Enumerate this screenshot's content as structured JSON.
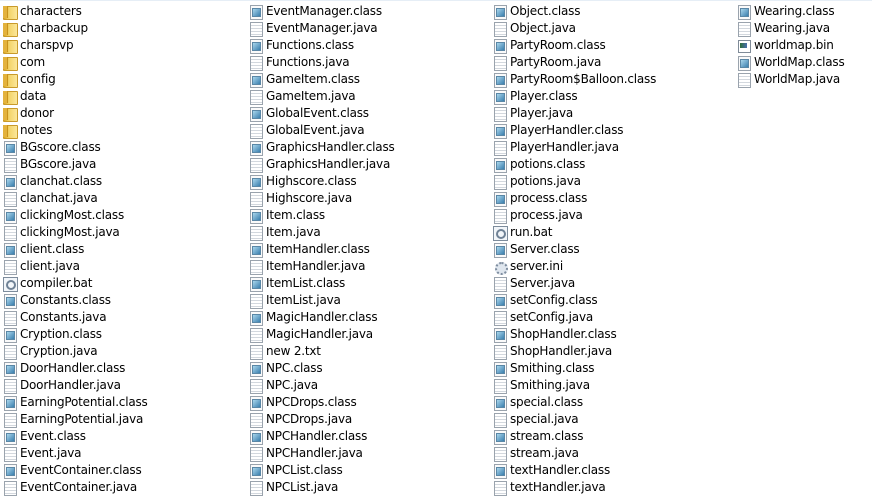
{
  "columns": [
    {
      "items": [
        {
          "name": "characters",
          "icon": "folder-icon",
          "type": "folder"
        },
        {
          "name": "charbackup",
          "icon": "folder-icon",
          "type": "folder"
        },
        {
          "name": "charspvp",
          "icon": "folder-icon",
          "type": "folder"
        },
        {
          "name": "com",
          "icon": "folder-icon",
          "type": "folder"
        },
        {
          "name": "config",
          "icon": "folder-icon",
          "type": "folder"
        },
        {
          "name": "data",
          "icon": "folder-icon",
          "type": "folder"
        },
        {
          "name": "donor",
          "icon": "folder-icon",
          "type": "folder"
        },
        {
          "name": "notes",
          "icon": "folder-icon",
          "type": "folder"
        },
        {
          "name": "BGscore.class",
          "icon": "class-file-icon",
          "type": "cls"
        },
        {
          "name": "BGscore.java",
          "icon": "text-file-icon",
          "type": "doc"
        },
        {
          "name": "clanchat.class",
          "icon": "class-file-icon",
          "type": "cls"
        },
        {
          "name": "clanchat.java",
          "icon": "text-file-icon",
          "type": "doc"
        },
        {
          "name": "clickingMost.class",
          "icon": "class-file-icon",
          "type": "cls"
        },
        {
          "name": "clickingMost.java",
          "icon": "text-file-icon",
          "type": "doc"
        },
        {
          "name": "client.class",
          "icon": "class-file-icon",
          "type": "cls"
        },
        {
          "name": "client.java",
          "icon": "text-file-icon",
          "type": "doc"
        },
        {
          "name": "compiler.bat",
          "icon": "batch-file-icon",
          "type": "bat"
        },
        {
          "name": "Constants.class",
          "icon": "class-file-icon",
          "type": "cls"
        },
        {
          "name": "Constants.java",
          "icon": "text-file-icon",
          "type": "doc"
        },
        {
          "name": "Cryption.class",
          "icon": "class-file-icon",
          "type": "cls"
        },
        {
          "name": "Cryption.java",
          "icon": "text-file-icon",
          "type": "doc"
        },
        {
          "name": "DoorHandler.class",
          "icon": "class-file-icon",
          "type": "cls"
        },
        {
          "name": "DoorHandler.java",
          "icon": "text-file-icon",
          "type": "doc"
        },
        {
          "name": "EarningPotential.class",
          "icon": "class-file-icon",
          "type": "cls"
        },
        {
          "name": "EarningPotential.java",
          "icon": "text-file-icon",
          "type": "doc"
        },
        {
          "name": "Event.class",
          "icon": "class-file-icon",
          "type": "cls"
        },
        {
          "name": "Event.java",
          "icon": "text-file-icon",
          "type": "doc"
        },
        {
          "name": "EventContainer.class",
          "icon": "class-file-icon",
          "type": "cls"
        },
        {
          "name": "EventContainer.java",
          "icon": "text-file-icon",
          "type": "doc"
        }
      ]
    },
    {
      "items": [
        {
          "name": "EventManager.class",
          "icon": "class-file-icon",
          "type": "cls"
        },
        {
          "name": "EventManager.java",
          "icon": "text-file-icon",
          "type": "doc"
        },
        {
          "name": "Functions.class",
          "icon": "class-file-icon",
          "type": "cls"
        },
        {
          "name": "Functions.java",
          "icon": "text-file-icon",
          "type": "doc"
        },
        {
          "name": "GameItem.class",
          "icon": "class-file-icon",
          "type": "cls"
        },
        {
          "name": "GameItem.java",
          "icon": "text-file-icon",
          "type": "doc"
        },
        {
          "name": "GlobalEvent.class",
          "icon": "class-file-icon",
          "type": "cls"
        },
        {
          "name": "GlobalEvent.java",
          "icon": "text-file-icon",
          "type": "doc"
        },
        {
          "name": "GraphicsHandler.class",
          "icon": "class-file-icon",
          "type": "cls"
        },
        {
          "name": "GraphicsHandler.java",
          "icon": "text-file-icon",
          "type": "doc"
        },
        {
          "name": "Highscore.class",
          "icon": "class-file-icon",
          "type": "cls"
        },
        {
          "name": "Highscore.java",
          "icon": "text-file-icon",
          "type": "doc"
        },
        {
          "name": "Item.class",
          "icon": "class-file-icon",
          "type": "cls"
        },
        {
          "name": "Item.java",
          "icon": "text-file-icon",
          "type": "doc"
        },
        {
          "name": "ItemHandler.class",
          "icon": "class-file-icon",
          "type": "cls"
        },
        {
          "name": "ItemHandler.java",
          "icon": "text-file-icon",
          "type": "doc"
        },
        {
          "name": "ItemList.class",
          "icon": "class-file-icon",
          "type": "cls"
        },
        {
          "name": "ItemList.java",
          "icon": "text-file-icon",
          "type": "doc"
        },
        {
          "name": "MagicHandler.class",
          "icon": "class-file-icon",
          "type": "cls"
        },
        {
          "name": "MagicHandler.java",
          "icon": "text-file-icon",
          "type": "doc"
        },
        {
          "name": "new  2.txt",
          "icon": "text-file-icon",
          "type": "doc"
        },
        {
          "name": "NPC.class",
          "icon": "class-file-icon",
          "type": "cls"
        },
        {
          "name": "NPC.java",
          "icon": "text-file-icon",
          "type": "doc"
        },
        {
          "name": "NPCDrops.class",
          "icon": "class-file-icon",
          "type": "cls"
        },
        {
          "name": "NPCDrops.java",
          "icon": "text-file-icon",
          "type": "doc"
        },
        {
          "name": "NPCHandler.class",
          "icon": "class-file-icon",
          "type": "cls"
        },
        {
          "name": "NPCHandler.java",
          "icon": "text-file-icon",
          "type": "doc"
        },
        {
          "name": "NPCList.class",
          "icon": "class-file-icon",
          "type": "cls"
        },
        {
          "name": "NPCList.java",
          "icon": "text-file-icon",
          "type": "doc"
        }
      ]
    },
    {
      "items": [
        {
          "name": "Object.class",
          "icon": "class-file-icon",
          "type": "cls"
        },
        {
          "name": "Object.java",
          "icon": "text-file-icon",
          "type": "doc"
        },
        {
          "name": "PartyRoom.class",
          "icon": "class-file-icon",
          "type": "cls"
        },
        {
          "name": "PartyRoom.java",
          "icon": "text-file-icon",
          "type": "doc"
        },
        {
          "name": "PartyRoom$Balloon.class",
          "icon": "class-file-icon",
          "type": "cls"
        },
        {
          "name": "Player.class",
          "icon": "class-file-icon",
          "type": "cls"
        },
        {
          "name": "Player.java",
          "icon": "text-file-icon",
          "type": "doc"
        },
        {
          "name": "PlayerHandler.class",
          "icon": "class-file-icon",
          "type": "cls"
        },
        {
          "name": "PlayerHandler.java",
          "icon": "text-file-icon",
          "type": "doc"
        },
        {
          "name": "potions.class",
          "icon": "class-file-icon",
          "type": "cls"
        },
        {
          "name": "potions.java",
          "icon": "text-file-icon",
          "type": "doc"
        },
        {
          "name": "process.class",
          "icon": "class-file-icon",
          "type": "cls"
        },
        {
          "name": "process.java",
          "icon": "text-file-icon",
          "type": "doc"
        },
        {
          "name": "run.bat",
          "icon": "batch-file-icon",
          "type": "bat"
        },
        {
          "name": "Server.class",
          "icon": "class-file-icon",
          "type": "cls"
        },
        {
          "name": "server.ini",
          "icon": "settings-file-icon",
          "type": "ini"
        },
        {
          "name": "Server.java",
          "icon": "text-file-icon",
          "type": "doc"
        },
        {
          "name": "setConfig.class",
          "icon": "class-file-icon",
          "type": "cls"
        },
        {
          "name": "setConfig.java",
          "icon": "text-file-icon",
          "type": "doc"
        },
        {
          "name": "ShopHandler.class",
          "icon": "class-file-icon",
          "type": "cls"
        },
        {
          "name": "ShopHandler.java",
          "icon": "text-file-icon",
          "type": "doc"
        },
        {
          "name": "Smithing.class",
          "icon": "class-file-icon",
          "type": "cls"
        },
        {
          "name": "Smithing.java",
          "icon": "text-file-icon",
          "type": "doc"
        },
        {
          "name": "special.class",
          "icon": "class-file-icon",
          "type": "cls"
        },
        {
          "name": "special.java",
          "icon": "text-file-icon",
          "type": "doc"
        },
        {
          "name": "stream.class",
          "icon": "class-file-icon",
          "type": "cls"
        },
        {
          "name": "stream.java",
          "icon": "text-file-icon",
          "type": "doc"
        },
        {
          "name": "textHandler.class",
          "icon": "class-file-icon",
          "type": "cls"
        },
        {
          "name": "textHandler.java",
          "icon": "text-file-icon",
          "type": "doc"
        }
      ]
    },
    {
      "items": [
        {
          "name": "Wearing.class",
          "icon": "class-file-icon",
          "type": "cls"
        },
        {
          "name": "Wearing.java",
          "icon": "text-file-icon",
          "type": "doc"
        },
        {
          "name": "worldmap.bin",
          "icon": "binary-file-icon",
          "type": "bin"
        },
        {
          "name": "WorldMap.class",
          "icon": "class-file-icon",
          "type": "cls"
        },
        {
          "name": "WorldMap.java",
          "icon": "text-file-icon",
          "type": "doc"
        }
      ]
    }
  ]
}
